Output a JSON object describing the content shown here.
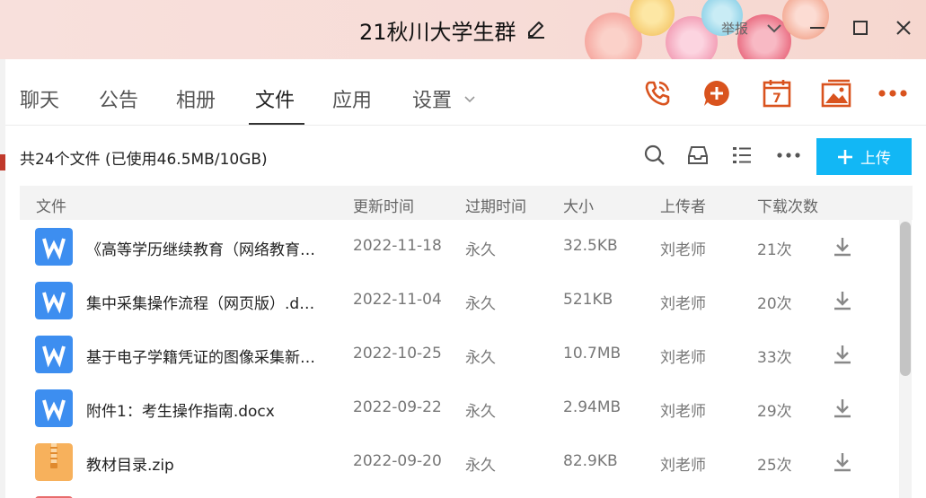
{
  "window": {
    "title": "21秋川大学生群",
    "report_label": "举报"
  },
  "tabs": [
    {
      "label": "聊天"
    },
    {
      "label": "公告"
    },
    {
      "label": "相册"
    },
    {
      "label": "文件"
    },
    {
      "label": "应用"
    },
    {
      "label": "设置"
    }
  ],
  "active_tab": "文件",
  "tool_icons": [
    "phone-call-icon",
    "add-chat-icon",
    "calendar-icon",
    "album-icon",
    "more-icon"
  ],
  "calendar_day": "7",
  "summary": "共24个文件 (已使用46.5MB/10GB)",
  "upload_label": "上传",
  "columns": {
    "file": "文件",
    "updated": "更新时间",
    "expires": "过期时间",
    "size": "大小",
    "uploader": "上传者",
    "downloads": "下载次数"
  },
  "files": [
    {
      "type": "word",
      "name": "《高等学历继续教育（网络教育…",
      "updated": "2022-11-18",
      "expires": "永久",
      "size": "32.5KB",
      "uploader": "刘老师",
      "downloads": "21次"
    },
    {
      "type": "word",
      "name": "集中采集操作流程（网页版）.d…",
      "updated": "2022-11-04",
      "expires": "永久",
      "size": "521KB",
      "uploader": "刘老师",
      "downloads": "20次"
    },
    {
      "type": "word",
      "name": "基于电子学籍凭证的图像采集新…",
      "updated": "2022-10-25",
      "expires": "永久",
      "size": "10.7MB",
      "uploader": "刘老师",
      "downloads": "33次"
    },
    {
      "type": "word",
      "name": "附件1：考生操作指南.docx",
      "updated": "2022-09-22",
      "expires": "永久",
      "size": "2.94MB",
      "uploader": "刘老师",
      "downloads": "29次"
    },
    {
      "type": "zip",
      "name": "教材目录.zip",
      "updated": "2022-09-20",
      "expires": "永久",
      "size": "82.9KB",
      "uploader": "刘老师",
      "downloads": "25次"
    }
  ],
  "colors": {
    "accent": "#12b7f5",
    "icon_orange": "#d9531e",
    "word_blue": "#3d8ef0",
    "zip_orange": "#f7b15c"
  }
}
